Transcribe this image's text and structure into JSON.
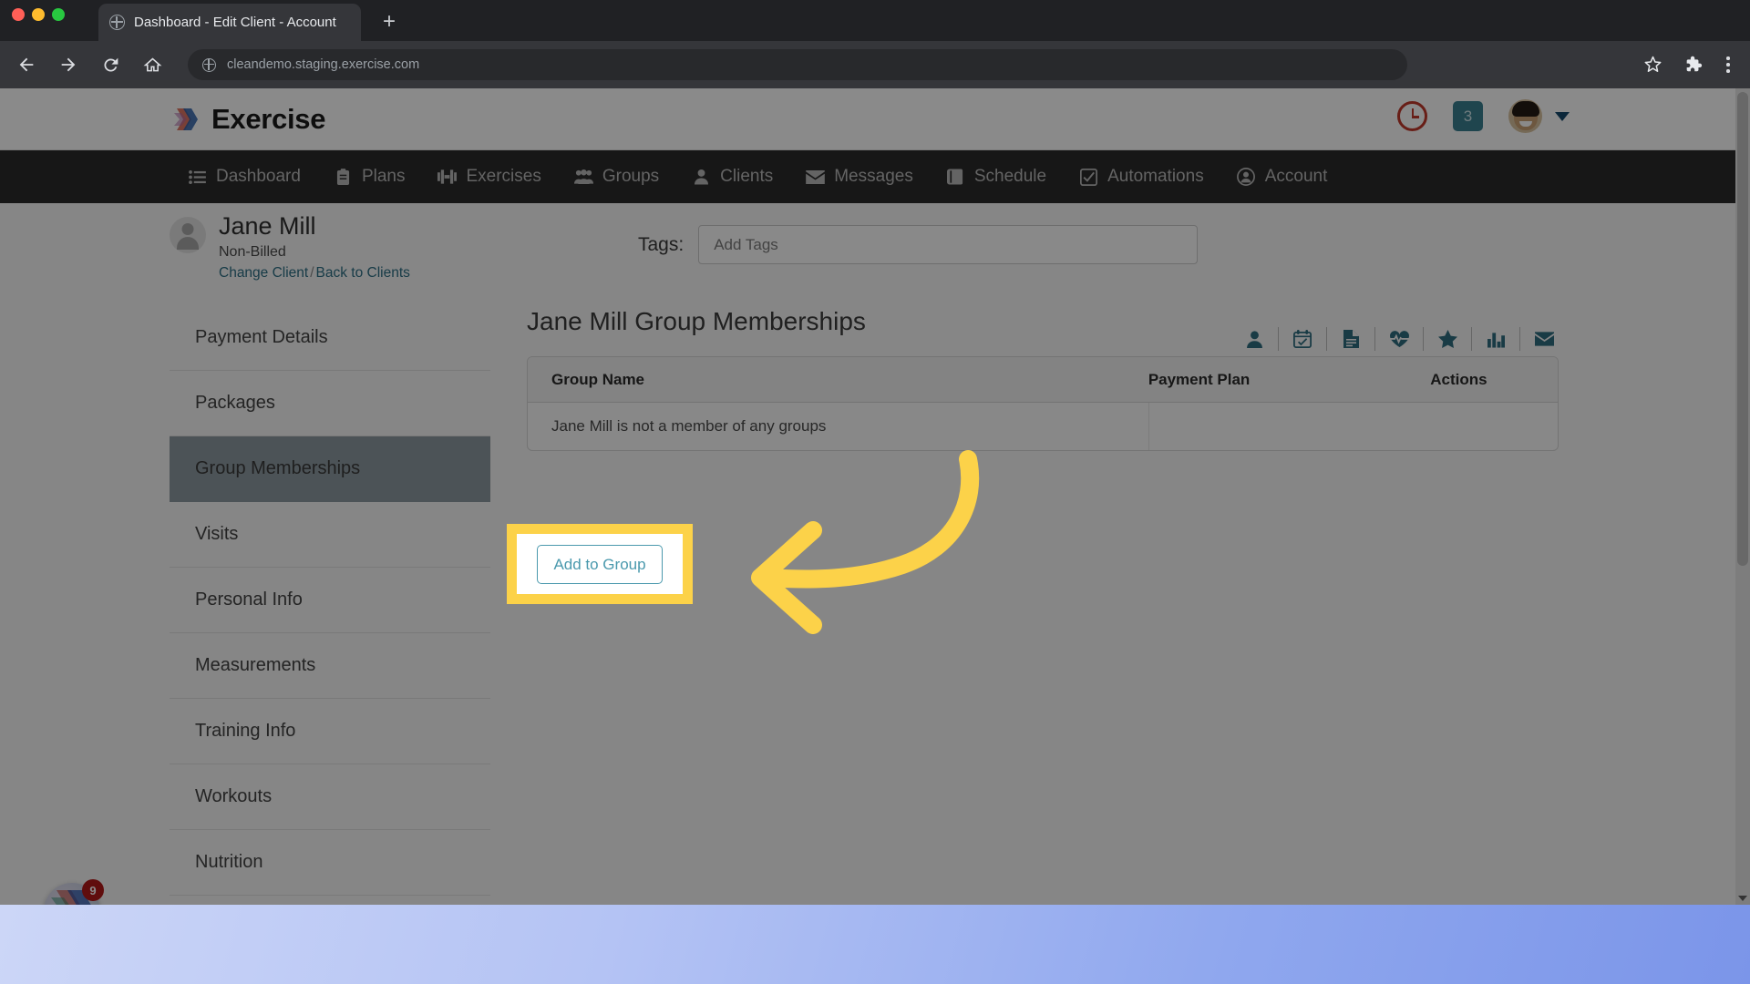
{
  "browser": {
    "tab": {
      "title": "Dashboard - Edit Client - Account",
      "favicon": "globe-icon"
    },
    "new_tab_label": "+",
    "back_icon": "back-arrow-icon",
    "forward_icon": "forward-arrow-icon",
    "reload_icon": "reload-icon",
    "home_icon": "home-icon",
    "url": "cleandemo.staging.exercise.com",
    "bookmark_icon": "star-outline-icon",
    "extensions_icon": "puzzle-piece-icon",
    "menu_icon": "three-dot-menu-icon"
  },
  "site_header": {
    "brand_name": "Exercise",
    "brand_logo": "exercise-chevrons-logo",
    "clock_icon": "clock-icon",
    "notifications_count": "3",
    "avatar": "user-avatar",
    "chevron": "chevron-down-icon"
  },
  "main_nav": {
    "items": [
      {
        "label": "Dashboard",
        "icon": "list-icon"
      },
      {
        "label": "Plans",
        "icon": "clipboard-icon"
      },
      {
        "label": "Exercises",
        "icon": "dumbbell-icon"
      },
      {
        "label": "Groups",
        "icon": "people-group-icon"
      },
      {
        "label": "Clients",
        "icon": "person-icon"
      },
      {
        "label": "Messages",
        "icon": "envelope-icon"
      },
      {
        "label": "Schedule",
        "icon": "book-icon"
      },
      {
        "label": "Automations",
        "icon": "checkbox-icon"
      },
      {
        "label": "Account",
        "icon": "user-circle-icon"
      }
    ]
  },
  "client": {
    "avatar": "client-placeholder-avatar",
    "name": "Jane Mill",
    "status": "Non-Billed",
    "change_client_link": "Change Client",
    "link_separator": "/",
    "back_to_clients_link": "Back to Clients"
  },
  "tags": {
    "label": "Tags:",
    "placeholder": "Add Tags",
    "value": ""
  },
  "client_tools": [
    {
      "icon": "person-icon"
    },
    {
      "icon": "calendar-check-icon"
    },
    {
      "icon": "document-icon"
    },
    {
      "icon": "heartbeat-icon"
    },
    {
      "icon": "star-icon"
    },
    {
      "icon": "bar-chart-icon"
    },
    {
      "icon": "envelope-icon"
    }
  ],
  "sidebar": {
    "items": [
      {
        "label": "Payment Details",
        "active": false
      },
      {
        "label": "Packages",
        "active": false
      },
      {
        "label": "Group Memberships",
        "active": true
      },
      {
        "label": "Visits",
        "active": false
      },
      {
        "label": "Personal Info",
        "active": false
      },
      {
        "label": "Measurements",
        "active": false
      },
      {
        "label": "Training Info",
        "active": false
      },
      {
        "label": "Workouts",
        "active": false
      },
      {
        "label": "Nutrition",
        "active": false
      }
    ]
  },
  "content": {
    "title": "Jane Mill Group Memberships",
    "table": {
      "headers": {
        "group_name": "Group Name",
        "payment_plan": "Payment Plan",
        "actions": "Actions"
      },
      "empty_message": "Jane Mill is not a member of any groups"
    },
    "add_to_group_label": "Add to Group"
  },
  "annotation": {
    "arrow_color": "#fcd249",
    "highlight_color": "#fcd249",
    "points_to": "Add to Group"
  },
  "chat_widget": {
    "badge_count": "9",
    "icon": "exercise-chevrons-logo"
  },
  "colors": {
    "accent_teal": "#2f6d80",
    "link_teal": "#2e6f85",
    "nav_bar": "#2b2b2b",
    "highlight_yellow": "#fcd249",
    "badge_red": "#b21818"
  }
}
